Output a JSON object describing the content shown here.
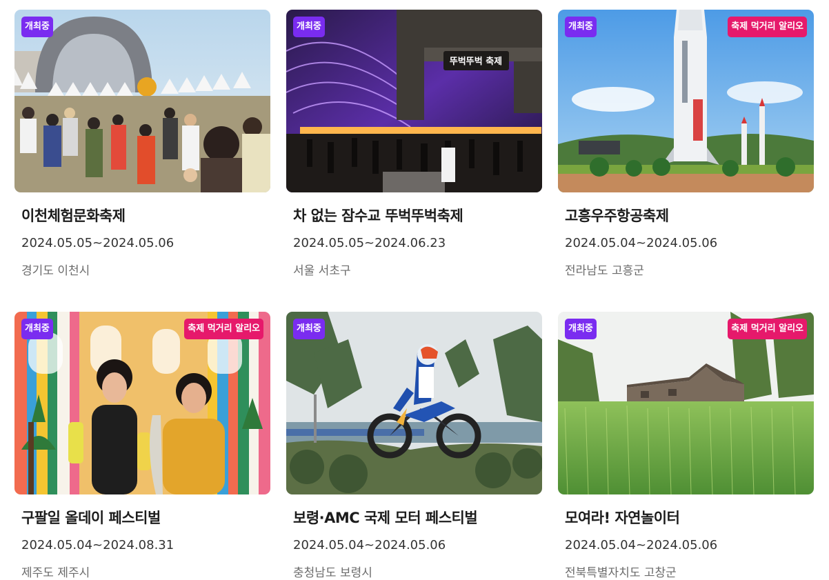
{
  "festivals": [
    {
      "title": "이천체험문화축제",
      "date": "2024.05.05~2024.05.06",
      "location": "경기도 이천시",
      "status_badge": "개최중",
      "promo_badge": "",
      "image": "crowd-tents-arch-photo"
    },
    {
      "title": "차 없는 잠수교 뚜벅뚜벅축제",
      "date": "2024.05.05~2024.06.23",
      "location": "서울 서초구",
      "status_badge": "개최중",
      "promo_badge": "",
      "image": "night-bridge-fountain-photo",
      "image_sign_text": "뚜벅뚜벅 축제"
    },
    {
      "title": "고흥우주항공축제",
      "date": "2024.05.04~2024.05.06",
      "location": "전라남도 고흥군",
      "status_badge": "개최중",
      "promo_badge": "축제 먹거리 알리오",
      "image": "rocket-monument-photo"
    },
    {
      "title": "구팔일 올데이 페스티벌",
      "date": "2024.05.04~2024.08.31",
      "location": "제주도 제주시",
      "status_badge": "개최중",
      "promo_badge": "축제 먹거리 알리오",
      "image": "two-women-drinks-photo"
    },
    {
      "title": "보령·AMC 국제 모터 페스티벌",
      "date": "2024.05.04~2024.05.06",
      "location": "충청남도 보령시",
      "status_badge": "개최중",
      "promo_badge": "",
      "image": "motocross-jump-photo"
    },
    {
      "title": "모여라! 자연놀이터",
      "date": "2024.05.04~2024.05.06",
      "location": "전북특별자치도 고창군",
      "status_badge": "개최중",
      "promo_badge": "축제 먹거리 알리오",
      "image": "barley-field-photo"
    }
  ],
  "colors": {
    "status_badge_bg": "#7a2cf0",
    "promo_badge_bg": "#e6196b",
    "title_text": "#1c1c1c",
    "date_text": "#333333",
    "location_text": "#6b6b6b"
  }
}
